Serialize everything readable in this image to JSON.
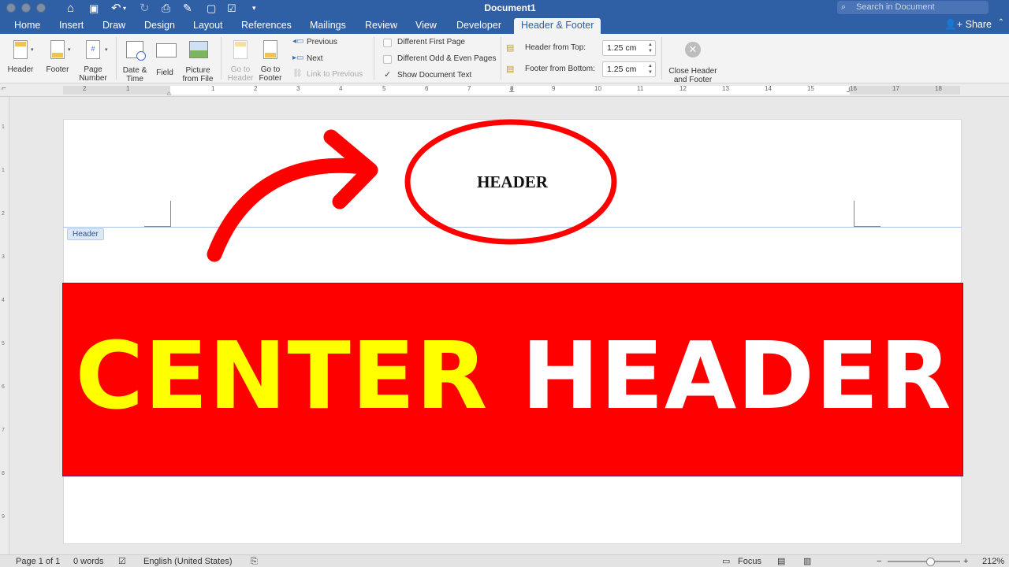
{
  "titlebar": {
    "document_title": "Document1",
    "search_placeholder": "Search in Document"
  },
  "tabs": [
    {
      "label": "Home"
    },
    {
      "label": "Insert"
    },
    {
      "label": "Draw"
    },
    {
      "label": "Design"
    },
    {
      "label": "Layout"
    },
    {
      "label": "References"
    },
    {
      "label": "Mailings"
    },
    {
      "label": "Review"
    },
    {
      "label": "View"
    },
    {
      "label": "Developer"
    },
    {
      "label": "Header & Footer",
      "active": true
    }
  ],
  "share_label": "Share",
  "ribbon": {
    "header": "Header",
    "footer": "Footer",
    "page_number_l1": "Page",
    "page_number_l2": "Number",
    "date_time_l1": "Date &",
    "date_time_l2": "Time",
    "field": "Field",
    "picture_l1": "Picture",
    "picture_l2": "from File",
    "go_header_l1": "Go to",
    "go_header_l2": "Header",
    "go_footer_l1": "Go to",
    "go_footer_l2": "Footer",
    "previous": "Previous",
    "next": "Next",
    "link_previous": "Link to Previous",
    "diff_first": "Different First Page",
    "diff_odd_even": "Different Odd & Even Pages",
    "show_doc_text": "Show Document Text",
    "header_from_top_label": "Header from Top:",
    "header_from_top_value": "1.25 cm",
    "footer_from_bottom_label": "Footer from Bottom:",
    "footer_from_bottom_value": "1.25 cm",
    "close_l1": "Close Header",
    "close_l2": "and Footer"
  },
  "ruler_numbers": [
    "2",
    "1",
    "1",
    "2",
    "3",
    "4",
    "5",
    "6",
    "7",
    "8",
    "9",
    "10",
    "11",
    "12",
    "13",
    "14",
    "15",
    "16",
    "17",
    "18"
  ],
  "document": {
    "header_text": "HEADER",
    "header_tag": "Header",
    "banner_word1": "CENTER",
    "banner_word2": "HEADER"
  },
  "statusbar": {
    "page": "Page 1 of 1",
    "words": "0 words",
    "language": "English (United States)",
    "focus": "Focus",
    "zoom": "212%"
  },
  "colors": {
    "ribbon_blue": "#2f5fa5",
    "banner_red": "#ff0000",
    "banner_yellow": "#ffff00",
    "annotation_red": "#ff0000"
  }
}
